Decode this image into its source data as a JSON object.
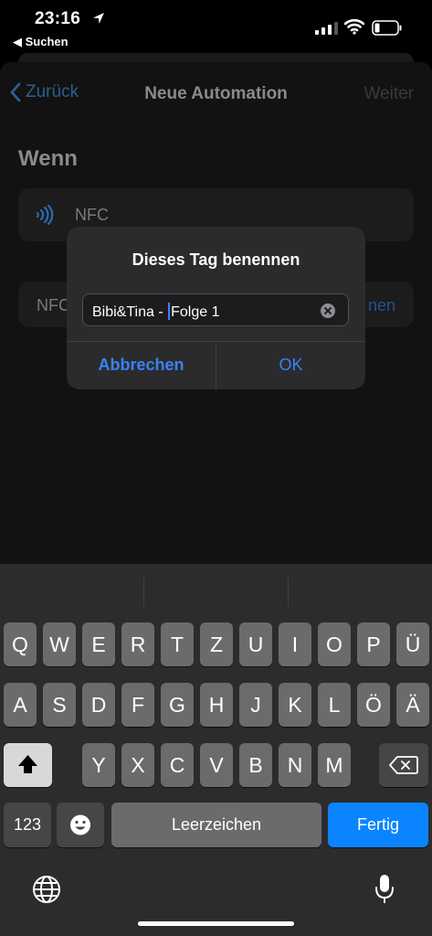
{
  "status": {
    "time": "23:16",
    "back_app": "◀ Suchen"
  },
  "nav": {
    "back_label": "Zurück",
    "title": "Neue Automation",
    "next_label": "Weiter"
  },
  "section": {
    "title": "Wenn"
  },
  "card_nfc": {
    "label": "NFC"
  },
  "card_tag": {
    "left_label": "NFC",
    "right_label": "nen"
  },
  "dialog": {
    "title": "Dieses Tag benennen",
    "value_before_cursor": "Bibi&Tina - ",
    "value_after_cursor": "Folge 1",
    "cancel_label": "Abbrechen",
    "ok_label": "OK"
  },
  "keyboard": {
    "row1": [
      "Q",
      "W",
      "E",
      "R",
      "T",
      "Z",
      "U",
      "I",
      "O",
      "P",
      "Ü"
    ],
    "row2": [
      "A",
      "S",
      "D",
      "F",
      "G",
      "H",
      "J",
      "K",
      "L",
      "Ö",
      "Ä"
    ],
    "row3": [
      "Y",
      "X",
      "C",
      "V",
      "B",
      "N",
      "M"
    ],
    "numbers_label": "123",
    "space_label": "Leerzeichen",
    "return_label": "Fertig"
  },
  "colors": {
    "accent": "#3a82f7",
    "return_key": "#0a84ff",
    "key": "#6b6b6d"
  }
}
